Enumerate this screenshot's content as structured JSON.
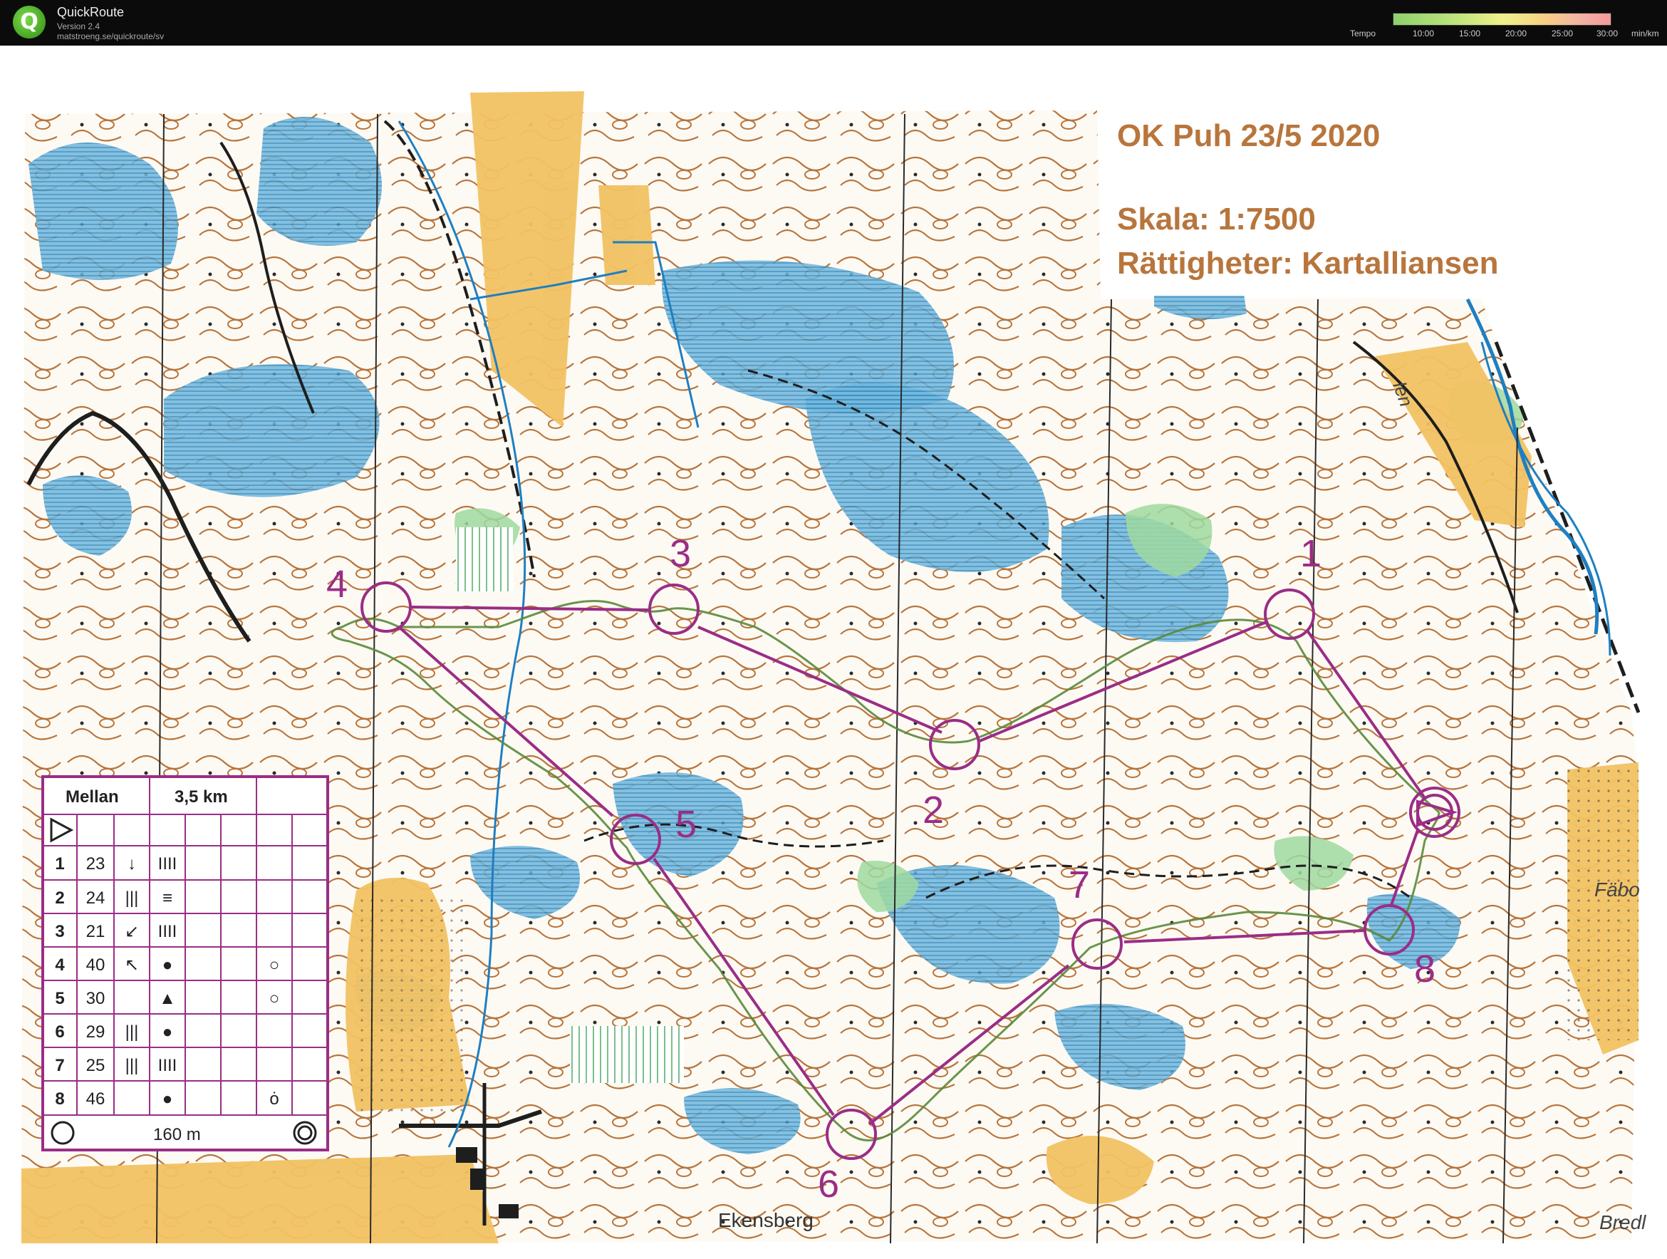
{
  "app": {
    "name": "QuickRoute",
    "version": "Version 2.4",
    "url": "matstroeng.se/quickroute/sv",
    "logo_letter": "Q"
  },
  "tempo": {
    "label": "Tempo",
    "ticks": [
      "10:00",
      "15:00",
      "20:00",
      "25:00",
      "30:00"
    ],
    "unit": "min/km"
  },
  "map_info": {
    "title": "OK Puh 23/5 2020",
    "scale": "Skala: 1:7500",
    "rights": "Rättigheter: Kartalliansen"
  },
  "place_names": [
    "Ekensberg",
    "Fäbo",
    "Bredl",
    "len"
  ],
  "controls": [
    {
      "number": "1"
    },
    {
      "number": "2"
    },
    {
      "number": "3"
    },
    {
      "number": "4"
    },
    {
      "number": "5"
    },
    {
      "number": "6"
    },
    {
      "number": "7"
    },
    {
      "number": "8"
    }
  ],
  "description_sheet": {
    "class": "Mellan",
    "length": "3,5 km",
    "rows": [
      {
        "n": "1",
        "code": "23",
        "symbol": "↓",
        "feature": "ΙΙΙΙ",
        "detail": ""
      },
      {
        "n": "2",
        "code": "24",
        "symbol": "|||",
        "feature": "≡",
        "detail": ""
      },
      {
        "n": "3",
        "code": "21",
        "symbol": "↙",
        "feature": "ΙΙΙΙ",
        "detail": ""
      },
      {
        "n": "4",
        "code": "40",
        "symbol": "↖",
        "feature": "●",
        "detail": "○"
      },
      {
        "n": "5",
        "code": "30",
        "symbol": "",
        "feature": "▲",
        "detail": "○"
      },
      {
        "n": "6",
        "code": "29",
        "symbol": "|||",
        "feature": "●",
        "detail": ""
      },
      {
        "n": "7",
        "code": "25",
        "symbol": "|||",
        "feature": "ΙΙΙΙ",
        "detail": ""
      },
      {
        "n": "8",
        "code": "46",
        "symbol": "",
        "feature": "●",
        "detail": "ȯ"
      }
    ],
    "finish_distance": "160 m"
  },
  "colors": {
    "course": "#9a2d86",
    "water": "#5aaed6",
    "open_land": "#f2c262",
    "contour": "#b8753c",
    "vegetation": "#8ccf86",
    "route": "#5a8a3a"
  }
}
